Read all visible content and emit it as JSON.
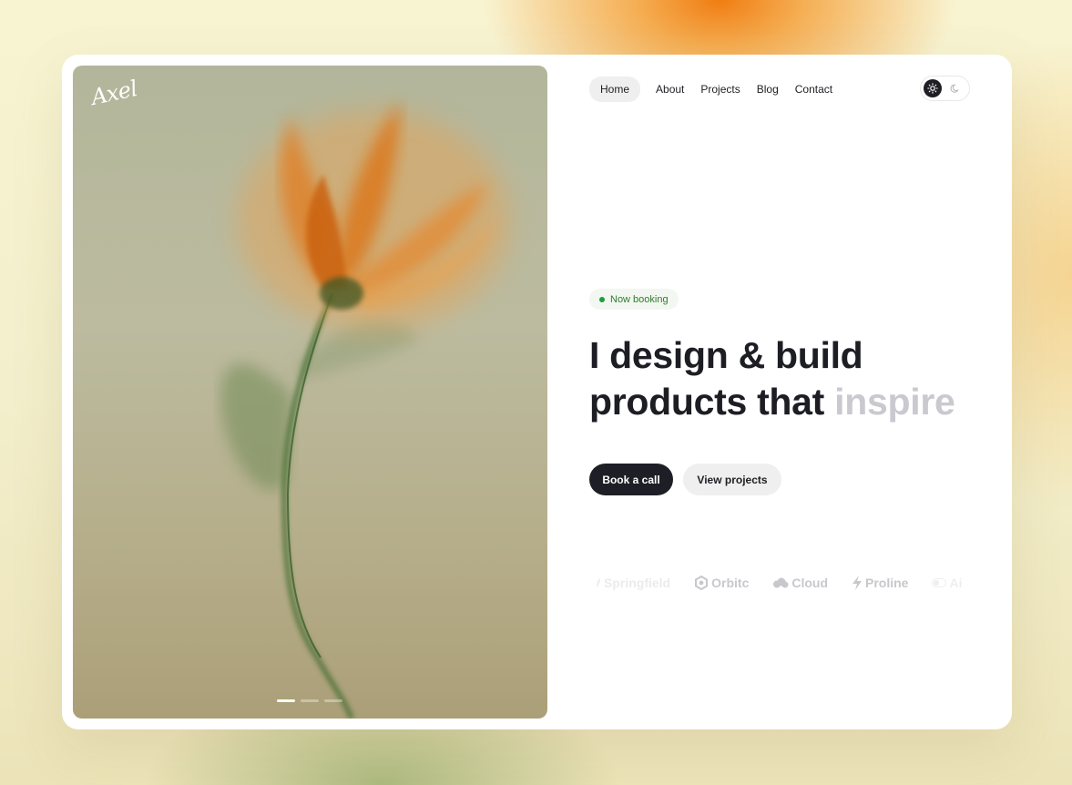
{
  "logo": {
    "text": "Axel"
  },
  "nav": {
    "items": [
      {
        "label": "Home",
        "active": true
      },
      {
        "label": "About"
      },
      {
        "label": "Projects"
      },
      {
        "label": "Blog"
      },
      {
        "label": "Contact"
      }
    ]
  },
  "theme": {
    "selected": "light",
    "light_icon": "sun-icon",
    "dark_icon": "moon-icon"
  },
  "badge": {
    "label": "Now booking",
    "color": "#1f9d3a"
  },
  "headline": {
    "line1": "I design & build",
    "line2_main": "products that",
    "line2_muted": "inspire"
  },
  "buttons": {
    "primary": "Book a call",
    "secondary": "View projects"
  },
  "brands": [
    {
      "name": "Springfield",
      "icon": "leaf-icon"
    },
    {
      "name": "Orbitc",
      "icon": "orbit-icon"
    },
    {
      "name": "Cloud",
      "icon": "cloud-icon"
    },
    {
      "name": "Proline",
      "icon": "bolt-icon"
    },
    {
      "name": "Ai",
      "icon": "toggle-icon"
    }
  ],
  "carousel": {
    "slides": 3,
    "active": 1
  },
  "colors": {
    "accent_dark": "#1e1e26",
    "muted_text": "#c9c9cf",
    "booking_green": "#1f9d3a"
  }
}
